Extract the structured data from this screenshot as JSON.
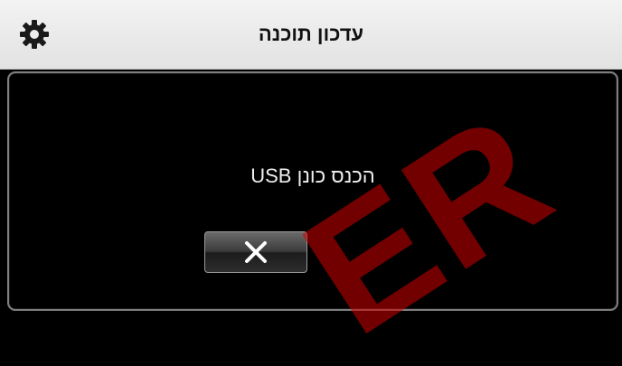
{
  "header": {
    "title": "עדכון תוכנה",
    "settings_icon": "gear-icon"
  },
  "dialog": {
    "message": "הכנס כונן USB",
    "close_icon": "close-icon"
  },
  "watermark": {
    "text": "ER"
  },
  "colors": {
    "header_bg": "#e9e9e9",
    "screen_bg": "#000000",
    "dialog_border": "#7f7f7f",
    "watermark": "#d20000"
  }
}
